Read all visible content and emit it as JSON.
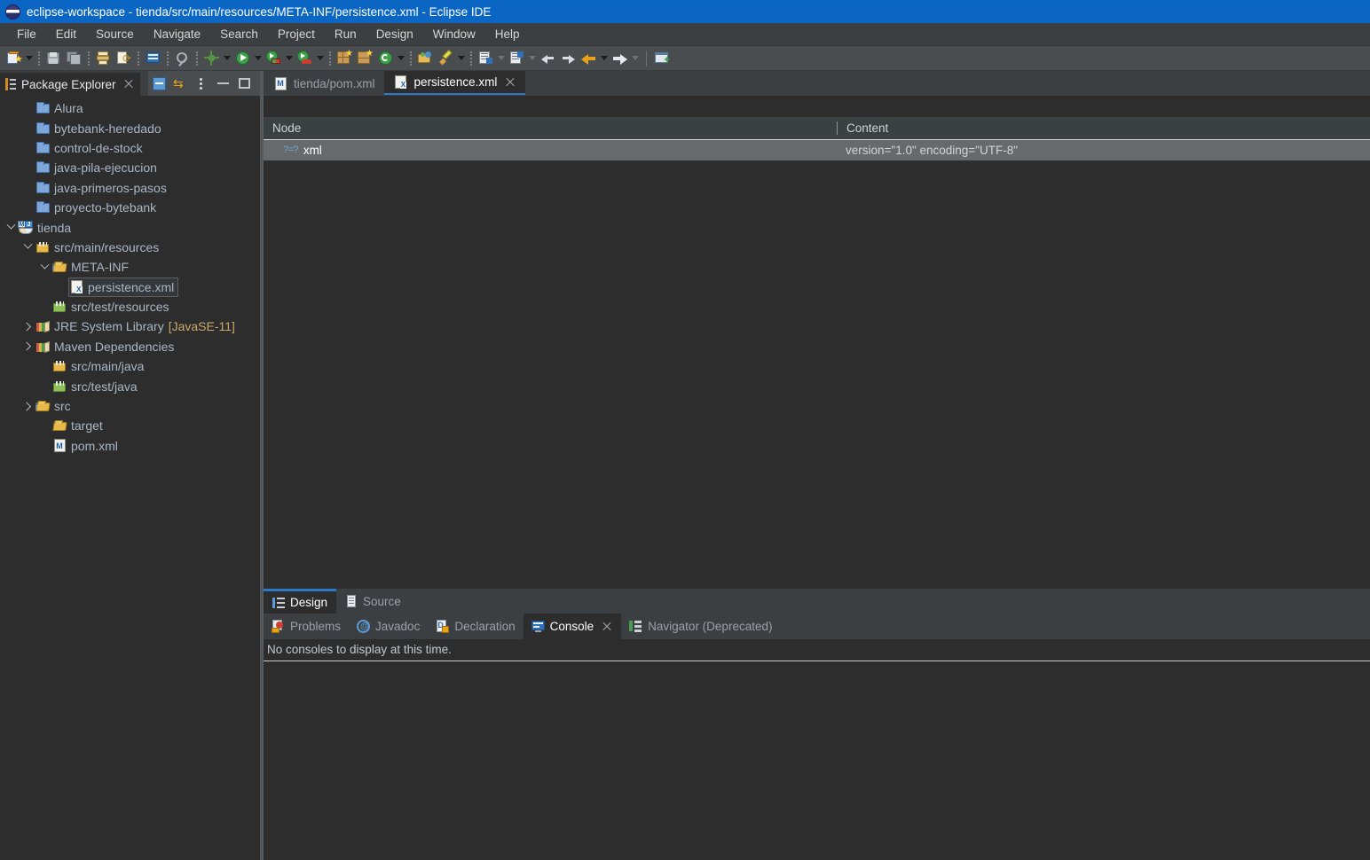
{
  "window": {
    "title": "eclipse-workspace - tienda/src/main/resources/META-INF/persistence.xml - Eclipse IDE",
    "logo_icon": "eclipse-logo-icon"
  },
  "menubar": {
    "items": [
      {
        "label": "File"
      },
      {
        "label": "Edit"
      },
      {
        "label": "Source"
      },
      {
        "label": "Navigate"
      },
      {
        "label": "Search"
      },
      {
        "label": "Project"
      },
      {
        "label": "Run"
      },
      {
        "label": "Design"
      },
      {
        "label": "Window"
      },
      {
        "label": "Help"
      }
    ]
  },
  "toolbar": {
    "buttons": [
      {
        "name": "new-wizard-icon"
      },
      {
        "name": "save-icon"
      },
      {
        "name": "save-all-icon"
      },
      {
        "name": "print-icon"
      },
      {
        "name": "refresh-workspace-icon"
      },
      {
        "name": "open-task-icon"
      },
      {
        "name": "search-icon"
      },
      {
        "name": "debug-icon"
      },
      {
        "name": "run-icon"
      },
      {
        "name": "coverage-icon"
      },
      {
        "name": "profile-icon"
      },
      {
        "name": "new-package-icon"
      },
      {
        "name": "new-class-icon"
      },
      {
        "name": "external-tools-icon"
      },
      {
        "name": "open-type-icon"
      },
      {
        "name": "marker-icon"
      },
      {
        "name": "next-annotation-icon"
      },
      {
        "name": "previous-annotation-icon"
      },
      {
        "name": "back-icon"
      },
      {
        "name": "forward-icon"
      },
      {
        "name": "back-history-icon"
      },
      {
        "name": "forward-history-icon"
      },
      {
        "name": "new-editor-icon"
      }
    ]
  },
  "explorer": {
    "title": "Package Explorer",
    "view_buttons": [
      {
        "name": "collapse-all-icon"
      },
      {
        "name": "link-with-editor-icon"
      },
      {
        "name": "view-menu-icon"
      },
      {
        "name": "minimize-view-icon"
      },
      {
        "name": "maximize-view-icon"
      }
    ],
    "tree": [
      {
        "label": "Alura",
        "icon": "folder-blue-icon",
        "indent": 1,
        "twisty": "none",
        "selected": false
      },
      {
        "label": "bytebank-heredado",
        "icon": "folder-blue-icon",
        "indent": 1,
        "twisty": "none",
        "selected": false
      },
      {
        "label": "control-de-stock",
        "icon": "folder-blue-icon",
        "indent": 1,
        "twisty": "none",
        "selected": false
      },
      {
        "label": "java-pila-ejecucion",
        "icon": "folder-blue-icon",
        "indent": 1,
        "twisty": "none",
        "selected": false
      },
      {
        "label": "java-primeros-pasos",
        "icon": "folder-blue-icon",
        "indent": 1,
        "twisty": "none",
        "selected": false
      },
      {
        "label": "proyecto-bytebank",
        "icon": "folder-blue-icon",
        "indent": 1,
        "twisty": "none",
        "selected": false
      },
      {
        "label": "tienda",
        "icon": "maven-project-icon",
        "indent": 0,
        "twisty": "open",
        "selected": false
      },
      {
        "label": "src/main/resources",
        "icon": "source-folder-icon",
        "indent": 1,
        "twisty": "open",
        "selected": false
      },
      {
        "label": "META-INF",
        "icon": "folder-package-icon",
        "indent": 2,
        "twisty": "open",
        "selected": false
      },
      {
        "label": "persistence.xml",
        "icon": "xml-file-icon",
        "indent": 3,
        "twisty": "none",
        "selected": true
      },
      {
        "label": "src/test/resources",
        "icon": "source-folder-green-icon",
        "indent": 2,
        "twisty": "none",
        "selected": false
      },
      {
        "label": "JRE System Library",
        "sublabel": "[JavaSE-11]",
        "icon": "library-icon",
        "indent": 1,
        "twisty": "closed",
        "selected": false
      },
      {
        "label": "Maven Dependencies",
        "icon": "library-icon",
        "indent": 1,
        "twisty": "closed",
        "selected": false
      },
      {
        "label": "src/main/java",
        "icon": "source-folder-icon",
        "indent": 2,
        "twisty": "none",
        "selected": false
      },
      {
        "label": "src/test/java",
        "icon": "source-folder-green-icon",
        "indent": 2,
        "twisty": "none",
        "selected": false
      },
      {
        "label": "src",
        "icon": "folder-package-icon",
        "indent": 1,
        "twisty": "closed",
        "selected": false
      },
      {
        "label": "target",
        "icon": "folder-yellow-icon",
        "indent": 2,
        "twisty": "none",
        "selected": false
      },
      {
        "label": "pom.xml",
        "icon": "maven-file-icon",
        "indent": 2,
        "twisty": "none",
        "selected": false
      }
    ]
  },
  "editor": {
    "tabs": [
      {
        "label": "tienda/pom.xml",
        "icon": "maven-file-icon",
        "active": false,
        "closable": false
      },
      {
        "label": "persistence.xml",
        "icon": "xml-file-icon",
        "active": true,
        "closable": true
      }
    ],
    "design_table": {
      "columns": [
        "Node",
        "Content"
      ],
      "rows": [
        {
          "node": "xml",
          "node_icon": "processing-instruction-icon",
          "content": "version=\"1.0\" encoding=\"UTF-8\""
        }
      ]
    },
    "view_tabs": [
      {
        "label": "Design",
        "icon": "design-view-icon",
        "active": true
      },
      {
        "label": "Source",
        "icon": "source-view-icon",
        "active": false
      }
    ]
  },
  "bottom_panel": {
    "tabs": [
      {
        "label": "Problems",
        "icon": "problems-icon",
        "active": false,
        "closable": false
      },
      {
        "label": "Javadoc",
        "icon": "javadoc-icon",
        "active": false,
        "closable": false
      },
      {
        "label": "Declaration",
        "icon": "declaration-icon",
        "active": false,
        "closable": false
      },
      {
        "label": "Console",
        "icon": "console-icon",
        "active": true,
        "closable": true
      },
      {
        "label": "Navigator (Deprecated)",
        "icon": "navigator-icon",
        "active": false,
        "closable": false
      }
    ],
    "console_message": "No consoles to display at this time."
  },
  "colors": {
    "title_bar": "#0a66c2",
    "accent_tab": "#2d79c7",
    "background": "#2d2d2d",
    "chrome": "#3c3f41",
    "toolbar": "#4a4d4f",
    "tree_text": "#a9b7c6",
    "sublabel": "#c9a86a",
    "selected_row": "#666a6c"
  }
}
